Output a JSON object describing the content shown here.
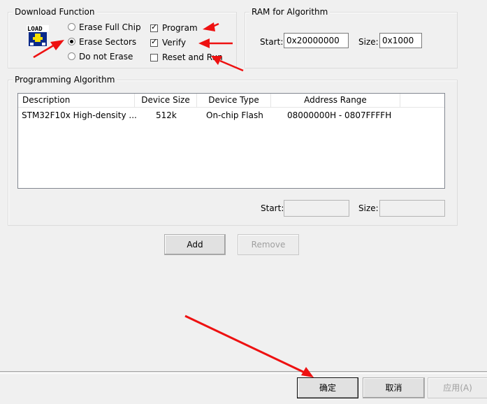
{
  "download_function": {
    "title": "Download Function",
    "icon": "load-icon",
    "erase_options": [
      {
        "label": "Erase Full Chip",
        "checked": false
      },
      {
        "label": "Erase Sectors",
        "checked": true
      },
      {
        "label": "Do not Erase",
        "checked": false
      }
    ],
    "checkboxes": [
      {
        "label": "Program",
        "checked": true
      },
      {
        "label": "Verify",
        "checked": true
      },
      {
        "label": "Reset and Run",
        "checked": false
      }
    ]
  },
  "ram_for_algorithm": {
    "title": "RAM for Algorithm",
    "start_label": "Start:",
    "start_value": "0x20000000",
    "size_label": "Size:",
    "size_value": "0x1000"
  },
  "programming_algorithm": {
    "title": "Programming Algorithm",
    "columns": [
      "Description",
      "Device Size",
      "Device Type",
      "Address Range"
    ],
    "rows": [
      {
        "description": "STM32F10x High-density ...",
        "device_size": "512k",
        "device_type": "On-chip Flash",
        "address_range": "08000000H - 0807FFFFH"
      }
    ],
    "start_label": "Start:",
    "start_value": "",
    "size_label": "Size:",
    "size_value": ""
  },
  "buttons": {
    "add": "Add",
    "remove": "Remove",
    "ok": "确定",
    "cancel": "取消",
    "apply": "应用(A)"
  },
  "annotation_color": "#ee1111"
}
